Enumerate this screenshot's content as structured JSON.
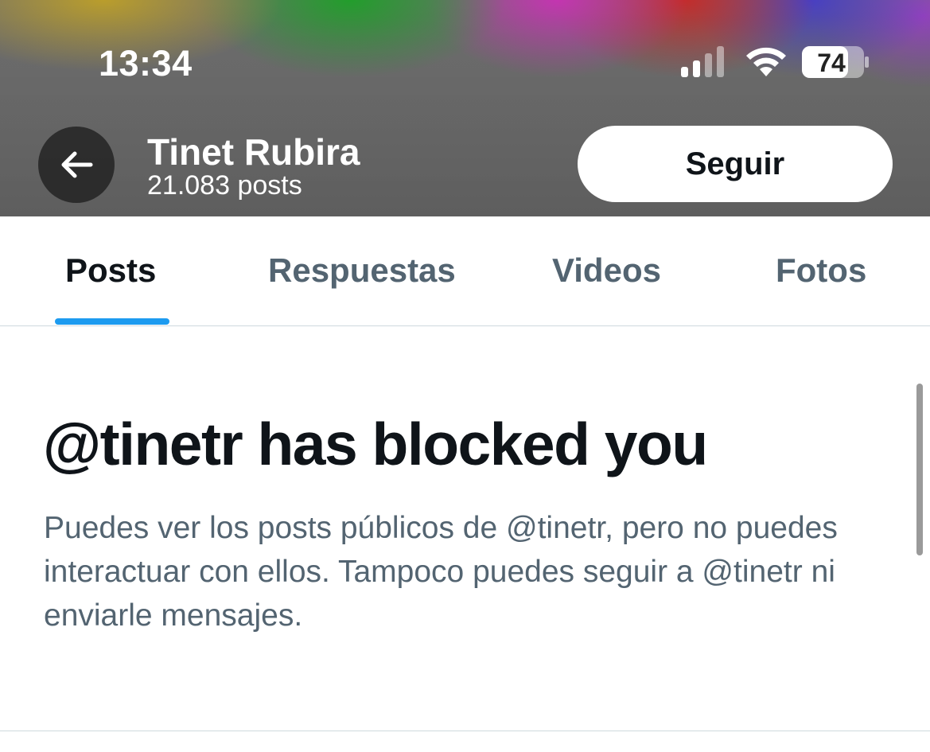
{
  "status_bar": {
    "time": "13:34",
    "battery_level": "74",
    "signal_icon": "cellular-signal-icon",
    "wifi_icon": "wifi-icon",
    "battery_icon": "battery-icon"
  },
  "header": {
    "back_icon": "arrow-left-icon",
    "name": "Tinet Rubira",
    "posts_count": "21.083 posts",
    "follow_label": "Seguir"
  },
  "tabs": [
    {
      "label": "Posts",
      "active": true
    },
    {
      "label": "Respuestas",
      "active": false
    },
    {
      "label": "Videos",
      "active": false
    },
    {
      "label": "Fotos",
      "active": false
    }
  ],
  "blocked": {
    "title": "@tinetr has blocked you",
    "description": "Puedes ver los posts públicos de @tinetr, pero no puedes interactuar con ellos. Tampoco puedes seguir a @tinetr ni enviarle mensajes."
  },
  "colors": {
    "accent": "#1d9bf0",
    "text_primary": "#0f1419",
    "text_secondary": "#536471"
  }
}
